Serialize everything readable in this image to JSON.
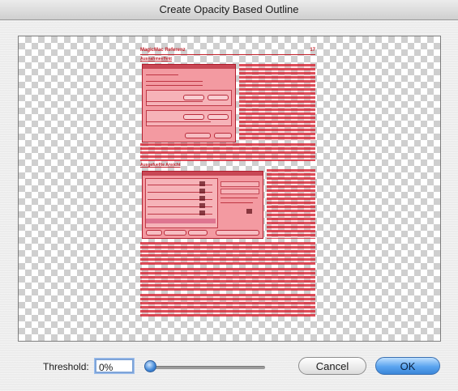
{
  "window": {
    "title": "Create Opacity Based Outline"
  },
  "preview": {
    "page_header_title": "MagicMac Referenz",
    "page_number": "17",
    "section_heading_1": "Ausnahmeeffekt",
    "section_heading_2": "Ausgefuellte Ansicht"
  },
  "controls": {
    "threshold_label": "Threshold:",
    "threshold_value": "0%",
    "threshold_percent": 0,
    "cancel_label": "Cancel",
    "ok_label": "OK"
  },
  "colors": {
    "outline": "#c2202a",
    "highlight": "#f39aa1",
    "default_button": "#5aa4ef",
    "focus_ring": "#7ea4d8"
  },
  "icons": {
    "slider_thumb": "circle-knob-icon"
  }
}
